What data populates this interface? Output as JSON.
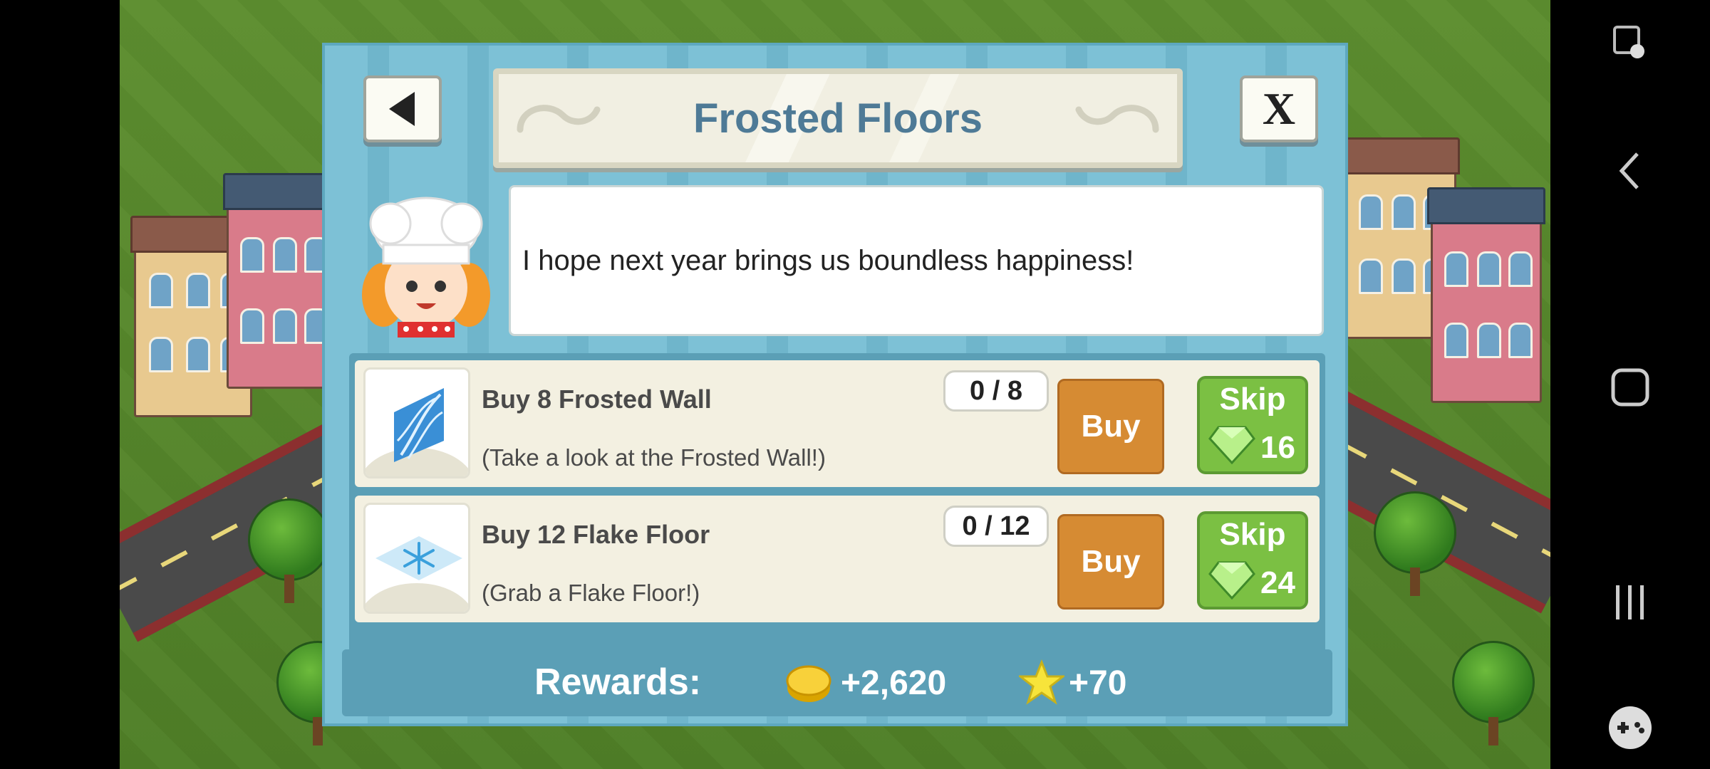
{
  "dialog": {
    "title": "Frosted Floors",
    "back_icon": "back-arrow-icon",
    "close_label": "X",
    "message": "I hope next year brings us boundless happiness!"
  },
  "tasks": [
    {
      "title": "Buy 8 Frosted Wall",
      "subtitle": "(Take a look at the Frosted Wall!)",
      "progress": "0 / 8",
      "buy_label": "Buy",
      "skip_label": "Skip",
      "skip_cost": "16",
      "icon": "frosted-wall-icon"
    },
    {
      "title": "Buy 12 Flake Floor",
      "subtitle": "(Grab a Flake Floor!)",
      "progress": "0 / 12",
      "buy_label": "Buy",
      "skip_label": "Skip",
      "skip_cost": "24",
      "icon": "flake-floor-icon"
    }
  ],
  "rewards": {
    "label": "Rewards:",
    "coins": "+2,620",
    "xp": "+70"
  },
  "colors": {
    "dialog_bg": "#7dc1d6",
    "title_text": "#4e7a96",
    "buy_button": "#d68b33",
    "skip_button": "#7bc043"
  }
}
